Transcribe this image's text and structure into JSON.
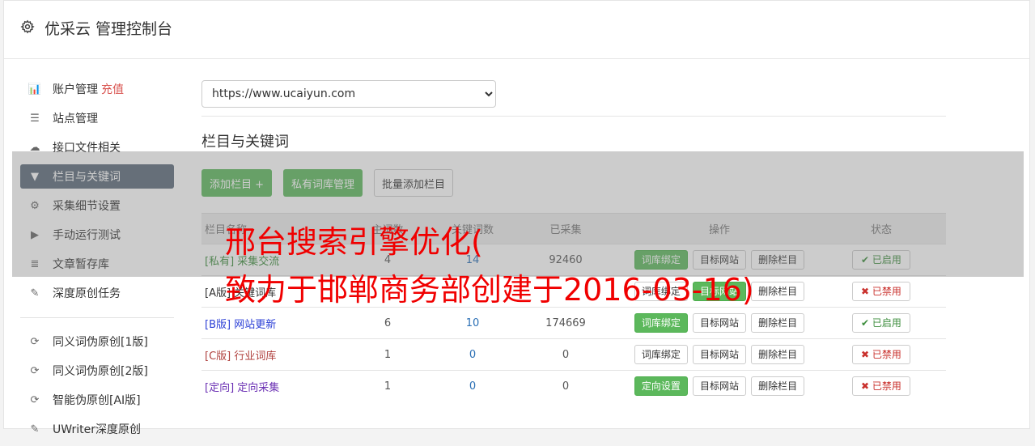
{
  "header": {
    "title": "优采云 管理控制台"
  },
  "sidebar": {
    "items": [
      {
        "label": "账户管理",
        "badge": "充值",
        "icon": "bar-chart-icon",
        "glyph": "📊"
      },
      {
        "label": "站点管理",
        "icon": "server-icon",
        "glyph": "☰"
      },
      {
        "label": "接口文件相关",
        "icon": "cloud-upload-icon",
        "glyph": "☁"
      },
      {
        "label": "栏目与关键词",
        "icon": "filter-icon",
        "glyph": "▼",
        "active": true
      },
      {
        "label": "采集细节设置",
        "icon": "gears-icon",
        "glyph": "⚙"
      },
      {
        "label": "手动运行测试",
        "icon": "play-circle-icon",
        "glyph": "▶"
      },
      {
        "label": "文章暂存库",
        "icon": "database-icon",
        "glyph": "≣"
      },
      {
        "label": "深度原创任务",
        "icon": "edit-icon",
        "glyph": "✎"
      }
    ],
    "items2": [
      {
        "label": "同义词伪原创[1版]",
        "icon": "refresh-icon",
        "glyph": "⟳"
      },
      {
        "label": "同义词伪原创[2版]",
        "icon": "refresh-icon",
        "glyph": "⟳"
      },
      {
        "label": "智能伪原创[AI版]",
        "icon": "refresh-icon",
        "glyph": "⟳"
      },
      {
        "label": "UWriter深度原创",
        "icon": "edit-icon",
        "glyph": "✎"
      }
    ]
  },
  "main": {
    "site_select": {
      "value": "https://www.ucaiyun.com"
    },
    "section_title": "栏目与关键词",
    "buttons": {
      "add_column": "添加栏目 +",
      "private_lib": "私有词库管理",
      "batch_add": "批量添加栏目"
    },
    "table": {
      "headers": [
        "栏目名称",
        "主词数",
        "关键词数",
        "已采集",
        "操作",
        "状态"
      ],
      "rows": [
        {
          "tag": "[私有]",
          "name": "采集交流",
          "color": "#3c8d3c",
          "main": "4",
          "kw": "14",
          "collected": "92460",
          "op1": "词库绑定",
          "op1_green": true,
          "op2": "目标网站",
          "op2_green": false,
          "op3": "删除栏目",
          "status": "已启用",
          "status_on": true
        },
        {
          "tag": "[A版]",
          "name": "关键词库",
          "color": "#333333",
          "main": "",
          "kw": "",
          "collected": "",
          "op1": "词库绑定",
          "op1_green": false,
          "op2": "目标网站",
          "op2_green": true,
          "op3": "删除栏目",
          "status": "已禁用",
          "status_on": false
        },
        {
          "tag": "[B版]",
          "name": "网站更新",
          "color": "#2b3fd6",
          "main": "6",
          "kw": "10",
          "collected": "174669",
          "op1": "词库绑定",
          "op1_green": true,
          "op2": "目标网站",
          "op2_green": false,
          "op3": "删除栏目",
          "status": "已启用",
          "status_on": true
        },
        {
          "tag": "[C版]",
          "name": "行业词库",
          "color": "#b0413e",
          "main": "1",
          "kw": "0",
          "collected": "0",
          "op1": "词库绑定",
          "op1_green": false,
          "op2": "目标网站",
          "op2_green": false,
          "op3": "删除栏目",
          "status": "已禁用",
          "status_on": false
        },
        {
          "tag": "[定向]",
          "name": "定向采集",
          "color": "#6a2fb3",
          "main": "1",
          "kw": "0",
          "collected": "0",
          "op1": "定向设置",
          "op1_green": true,
          "op2": "目标网站",
          "op2_green": false,
          "op3": "删除栏目",
          "status": "已禁用",
          "status_on": false
        }
      ]
    }
  },
  "watermark": {
    "line1": "邢台搜索引擎优化(",
    "line2": "致力于邯郸商务部创建于2016-03-16)"
  }
}
